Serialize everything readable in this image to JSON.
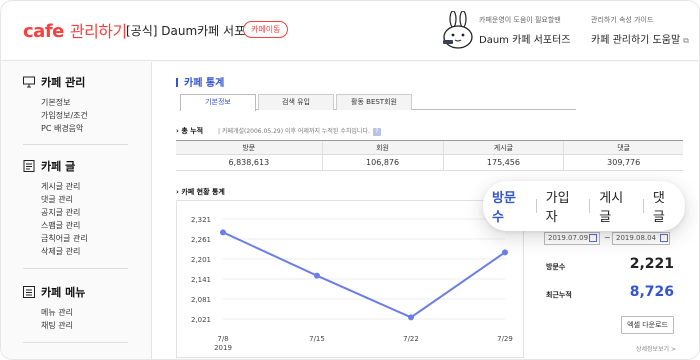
{
  "header": {
    "logo_main": "cafe",
    "logo_sub": "관리하기",
    "cafe_name": "[공식] Daum카페 서포터즈",
    "cafe_move": "카페이동",
    "helper_small": "카페운영이 도움이 필요할땐",
    "helper_main": "Daum 카페 서포터즈",
    "guide_small": "관리하기 속성 가이드",
    "guide_main": "카페 관리하기 도움말",
    "guide_icon": "external-link-icon"
  },
  "sidebar": {
    "sections": [
      {
        "title": "카페 관리",
        "icon": "monitor-icon",
        "items": [
          "기본정보",
          "가입정보/조건",
          "PC 배경음악"
        ]
      },
      {
        "title": "카페 글",
        "icon": "document-icon",
        "items": [
          "게시글 관리",
          "댓글 관리",
          "공지글 관리",
          "스팸글 관리",
          "금칙어글 관리",
          "삭제글 관리"
        ]
      },
      {
        "title": "카페 메뉴",
        "icon": "list-icon",
        "items": [
          "메뉴 관리",
          "채팅 관리"
        ]
      }
    ]
  },
  "main": {
    "title": "카페 통계",
    "tabs": [
      {
        "label": "기본정보",
        "active": true
      },
      {
        "label": "검색 유입",
        "active": false
      },
      {
        "label": "활동 BEST회원",
        "active": false
      }
    ],
    "total_label": "총 누적",
    "total_note": "카페개설(2006.05.29) 이후 어제까지 누적된 수치입니다.",
    "total_help": "?",
    "totals": {
      "headers": [
        "방문",
        "회원",
        "게시글",
        "댓글"
      ],
      "values": [
        "6,838,613",
        "106,876",
        "175,456",
        "309,776"
      ]
    },
    "chart_label": "카페 현황 통계",
    "date_from": "2019.07.09",
    "date_to": "2019.08.04",
    "date_sep": "~",
    "visits_label": "방문수",
    "visits_value": "2,221",
    "recent_label": "최근누적",
    "recent_value": "8,726",
    "excel_button": "엑셀 다운로드",
    "more_link": "상세정보보기 >"
  },
  "pill": {
    "items": [
      {
        "label": "방문수",
        "active": true
      },
      {
        "label": "가입자",
        "active": false
      },
      {
        "label": "게시글",
        "active": false
      },
      {
        "label": "댓글",
        "active": false
      }
    ]
  },
  "chart_data": {
    "type": "line",
    "categories": [
      "7/8",
      "7/15",
      "7/22",
      "7/29"
    ],
    "x_year_label": "2019",
    "series": [
      {
        "values": [
          2281,
          2151,
          2026,
          2221
        ]
      }
    ],
    "yticks": [
      "2,321",
      "2,261",
      "2,201",
      "2,141",
      "2,081",
      "2,021"
    ],
    "ylim": [
      2021,
      2321
    ],
    "color": "#6b7ee8",
    "grid": true
  }
}
